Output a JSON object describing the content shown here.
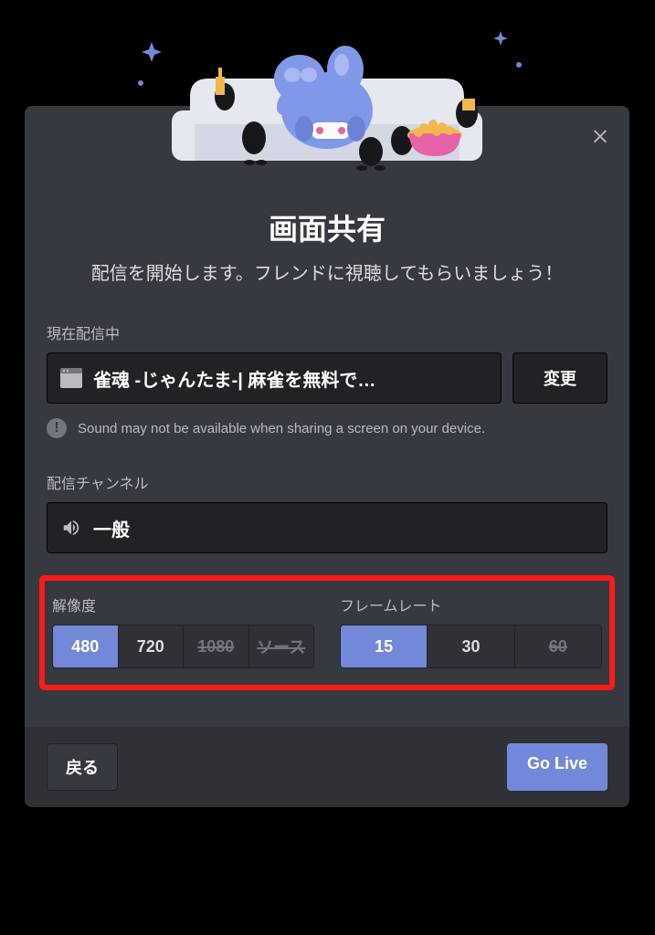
{
  "modal": {
    "title": "画面共有",
    "subtitle": "配信を開始します。フレンドに視聴してもらいましょう！"
  },
  "currentStream": {
    "label": "現在配信中",
    "source": "雀魂 -じゃんたま-| 麻雀を無料で…",
    "changeLabel": "変更"
  },
  "warning": {
    "text": "Sound may not be available when sharing a screen on your device."
  },
  "channel": {
    "label": "配信チャンネル",
    "name": "一般"
  },
  "resolution": {
    "label": "解像度",
    "options": [
      {
        "label": "480",
        "active": true,
        "locked": false
      },
      {
        "label": "720",
        "active": false,
        "locked": false
      },
      {
        "label": "1080",
        "active": false,
        "locked": true
      },
      {
        "label": "ソース",
        "active": false,
        "locked": true
      }
    ]
  },
  "frameRate": {
    "label": "フレームレート",
    "options": [
      {
        "label": "15",
        "active": true,
        "locked": false
      },
      {
        "label": "30",
        "active": false,
        "locked": false
      },
      {
        "label": "60",
        "active": false,
        "locked": true
      }
    ]
  },
  "footer": {
    "back": "戻る",
    "goLive": "Go Live"
  }
}
